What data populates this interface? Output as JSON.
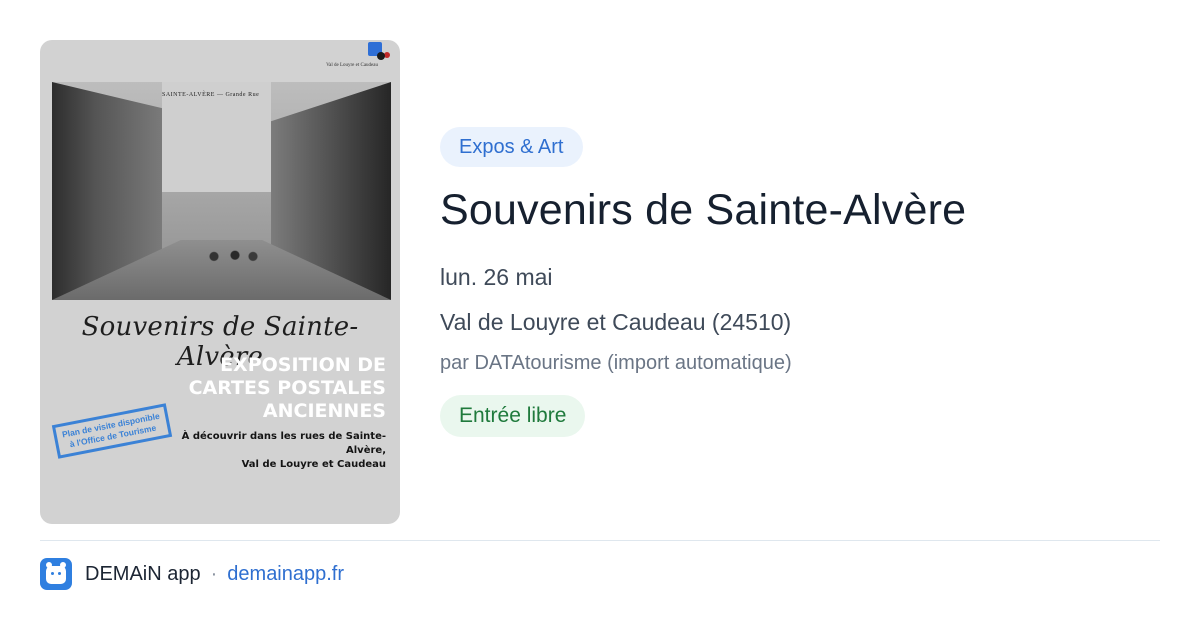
{
  "poster": {
    "logo_text": "Val de Louyre et Caudeau",
    "photo_caption": "SAINTE-ALVÈRE — Grande Rue",
    "script_title": "Souvenirs de Sainte-Alvère",
    "expo_heading": "EXPOSITION DE\nCARTES POSTALES\nANCIENNES",
    "subtext": "À découvrir dans les rues de Sainte-Alvère,\nVal de Louyre et Caudeau",
    "stamp": "Plan de visite disponible\nà l'Office de Tourisme"
  },
  "event": {
    "category": "Expos & Art",
    "title": "Souvenirs de Sainte-Alvère",
    "date": "lun. 26 mai",
    "location": "Val de Louyre et Caudeau (24510)",
    "author": "par DATAtourisme (import automatique)",
    "price": "Entrée libre"
  },
  "footer": {
    "app_name": "DEMAiN app",
    "separator": "·",
    "url": "demainapp.fr",
    "icon": "app-logo-icon"
  },
  "colors": {
    "category_bg": "#eaf2fd",
    "category_text": "#2f6fd0",
    "price_bg": "#eaf7ee",
    "price_text": "#1f7a3c",
    "title_text": "#16202f",
    "link": "#2f6fd0"
  }
}
